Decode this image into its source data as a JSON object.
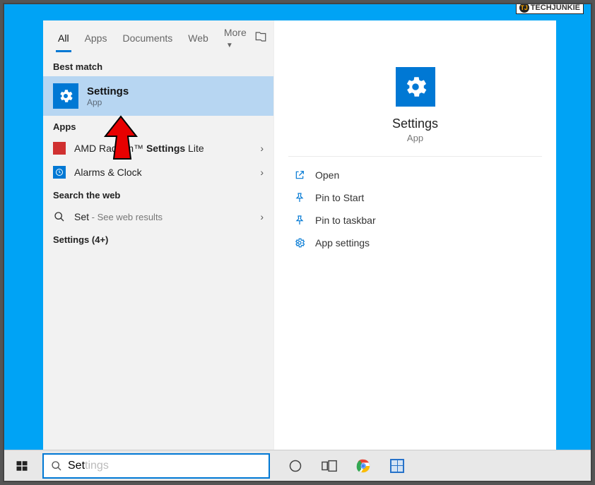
{
  "watermark": "TECHJUNKIE",
  "tabs": {
    "all": "All",
    "apps": "Apps",
    "documents": "Documents",
    "web": "Web",
    "more": "More"
  },
  "sections": {
    "best_match": "Best match",
    "apps": "Apps",
    "search_web": "Search the web",
    "settings_more": "Settings (4+)"
  },
  "best_match": {
    "title": "Settings",
    "subtitle": "App"
  },
  "app_results": {
    "amd": "AMD Radeon™ Settings Lite",
    "alarms": "Alarms & Clock"
  },
  "web_result": {
    "term": "Set",
    "hint": " - See web results"
  },
  "preview": {
    "title": "Settings",
    "subtitle": "App"
  },
  "actions": {
    "open": "Open",
    "pin_start": "Pin to Start",
    "pin_taskbar": "Pin to taskbar",
    "app_settings": "App settings"
  },
  "searchbox": {
    "typed": "Set",
    "placeholder": "tings"
  }
}
